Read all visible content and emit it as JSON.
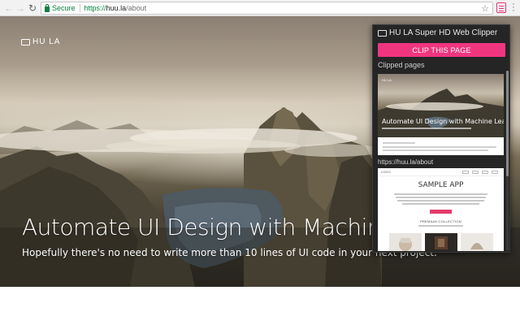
{
  "browser": {
    "secure_label": "Secure",
    "url_scheme": "https://",
    "url_host": "huu.la",
    "url_path": "/about",
    "back_icon": "arrow-left-icon",
    "forward_icon": "arrow-right-icon",
    "reload_icon": "reload-icon",
    "star_icon": "star-icon",
    "extension_icon": "huula-clipper-icon",
    "menu_icon": "vertical-dots-icon"
  },
  "hero": {
    "logo_text": "HU LA",
    "title": "Automate UI Design with Machine Le",
    "subtitle": "Hopefully there's no need to write more than 10 lines of UI code in your next project."
  },
  "popup": {
    "title": "HU LA Super HD Web Clipper",
    "clip_button": "CLIP THIS PAGE",
    "clipped_label": "Clipped pages",
    "accent_color": "#f0357f",
    "clips": [
      {
        "title": "Automate UI Design with Machine Learning",
        "logo": "HU LA",
        "url": "https://huu.la/about"
      },
      {
        "title": "SAMPLE APP",
        "logo": "LOGO",
        "section": "PREMIUM COLLECTION"
      }
    ]
  }
}
